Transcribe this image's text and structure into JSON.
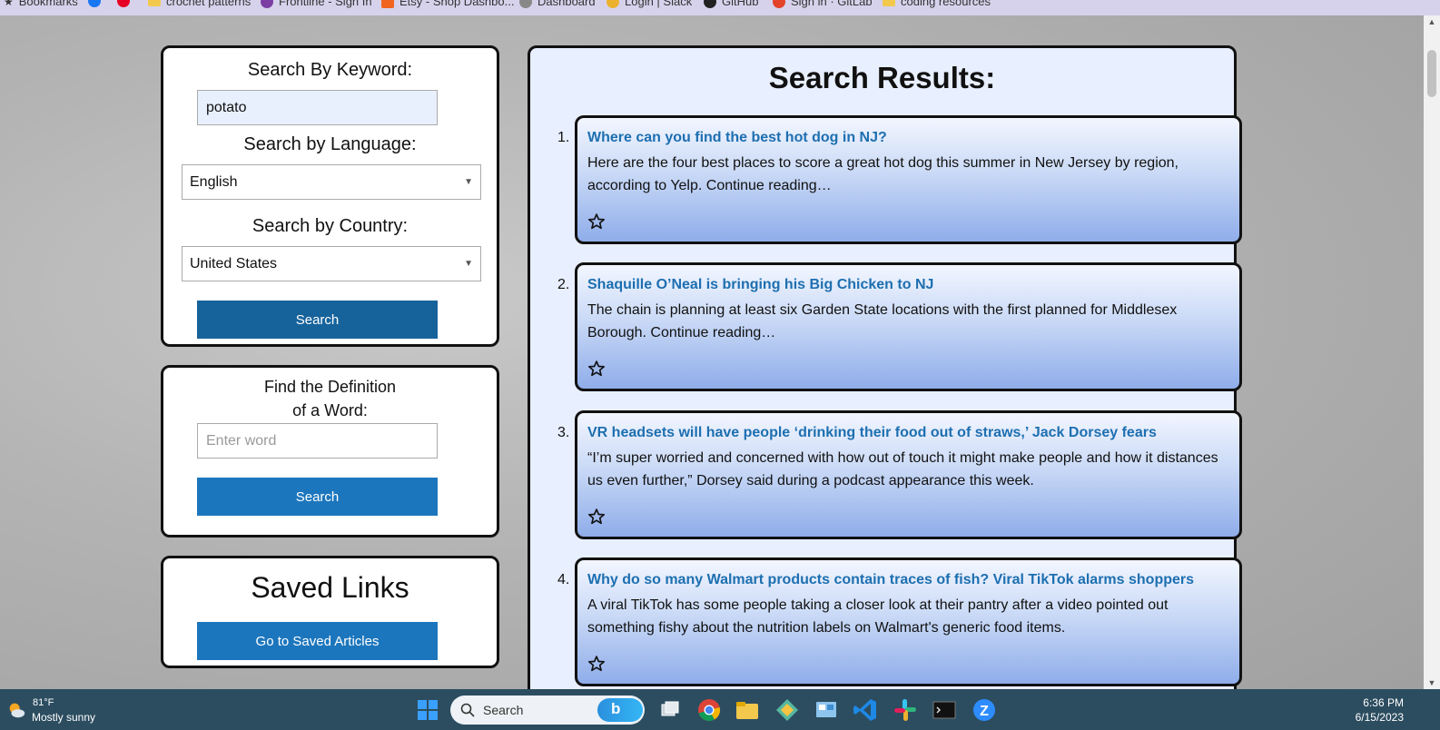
{
  "bookmarks": [
    {
      "label": "Bookmarks",
      "icon": "star-icon"
    },
    {
      "label": "",
      "icon": "facebook-icon"
    },
    {
      "label": "",
      "icon": "pinterest-icon"
    },
    {
      "label": "crochet patterns",
      "icon": "folder-icon"
    },
    {
      "label": "Frontline - Sign In",
      "icon": "frontline-icon"
    },
    {
      "label": "Etsy - Shop Dashbo...",
      "icon": "etsy-icon"
    },
    {
      "label": "Dashboard",
      "icon": "dashboard-icon"
    },
    {
      "label": "Login | Slack",
      "icon": "slack-icon"
    },
    {
      "label": "GitHub",
      "icon": "github-icon"
    },
    {
      "label": "Sign in · GitLab",
      "icon": "gitlab-icon"
    },
    {
      "label": "coding resources",
      "icon": "folder-icon"
    }
  ],
  "search_panel": {
    "keyword_label": "Search By Keyword:",
    "keyword_value": "potato",
    "language_label": "Search by Language:",
    "language_value": "English",
    "country_label": "Search by Country:",
    "country_value": "United States",
    "search_button": "Search"
  },
  "definition_panel": {
    "label_line1": "Find the Definition",
    "label_line2": "of a Word:",
    "placeholder": "Enter word",
    "search_button": "Search"
  },
  "saved_panel": {
    "title": "Saved Links",
    "button": "Go to Saved Articles"
  },
  "results": {
    "title": "Search Results:",
    "items": [
      {
        "number": "1.",
        "title": "Where can you find the best hot dog in NJ?",
        "description": "Here are the four best places to score a great hot dog this summer in New Jersey by region, according to Yelp. Continue reading…"
      },
      {
        "number": "2.",
        "title": "Shaquille O’Neal is bringing his Big Chicken to NJ",
        "description": "The chain is planning at least six Garden State locations with the first planned for Middlesex Borough. Continue reading…"
      },
      {
        "number": "3.",
        "title": "VR headsets will have people ‘drinking their food out of straws,’ Jack Dorsey fears",
        "description": "“I’m super worried and concerned with how out of touch it might make people and how it distances us even further,” Dorsey said during a podcast appearance this week."
      },
      {
        "number": "4.",
        "title": "Why do so many Walmart products contain traces of fish? Viral TikTok alarms shoppers",
        "description": "A viral TikTok has some people taking a closer look at their pantry after a video pointed out something fishy about the nutrition labels on Walmart's generic food items."
      }
    ]
  },
  "taskbar": {
    "temperature": "81°F",
    "weather": "Mostly sunny",
    "search_label": "Search",
    "time": "6:36 PM",
    "date": "6/15/2023"
  },
  "colors": {
    "button_dark": "#16639c",
    "button_blue": "#1c76bd",
    "result_title": "#1d6fb0",
    "taskbar": "#2c4d60"
  }
}
